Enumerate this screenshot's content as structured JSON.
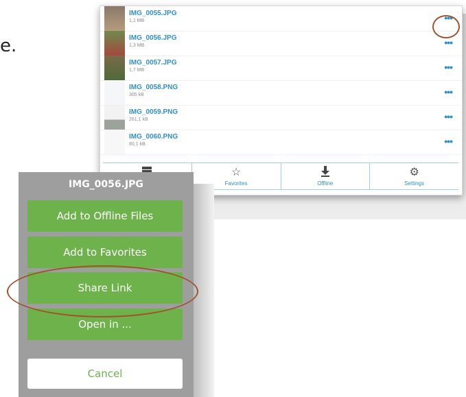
{
  "stray_text": "e.",
  "files": [
    {
      "name": "IMG_0055.JPG",
      "size": "1,1 MB"
    },
    {
      "name": "IMG_0056.JPG",
      "size": "1,3 MB"
    },
    {
      "name": "IMG_0057.JPG",
      "size": "1,7 MB"
    },
    {
      "name": "IMG_0058.PNG",
      "size": "305 kB"
    },
    {
      "name": "IMG_0059.PNG",
      "size": "261,1 kB"
    },
    {
      "name": "IMG_0060.PNG",
      "size": "80,1 kB"
    }
  ],
  "more_glyph": "•••",
  "tabs": [
    {
      "label": "",
      "icon": "server-icon"
    },
    {
      "label": "Favorites",
      "icon": "star-icon"
    },
    {
      "label": "Offline",
      "icon": "download-icon"
    },
    {
      "label": "Settings",
      "icon": "gear-icon"
    }
  ],
  "sheet": {
    "title": "IMG_0056.JPG",
    "buttons": [
      "Add to Offline Files",
      "Add to Favorites",
      "Share Link",
      "Open in ..."
    ],
    "cancel": "Cancel"
  },
  "colors": {
    "accent_blue": "#2f8fc7",
    "button_green": "#6db24a",
    "sheet_gray": "#9e9e9e",
    "highlight": "#a0522d"
  }
}
